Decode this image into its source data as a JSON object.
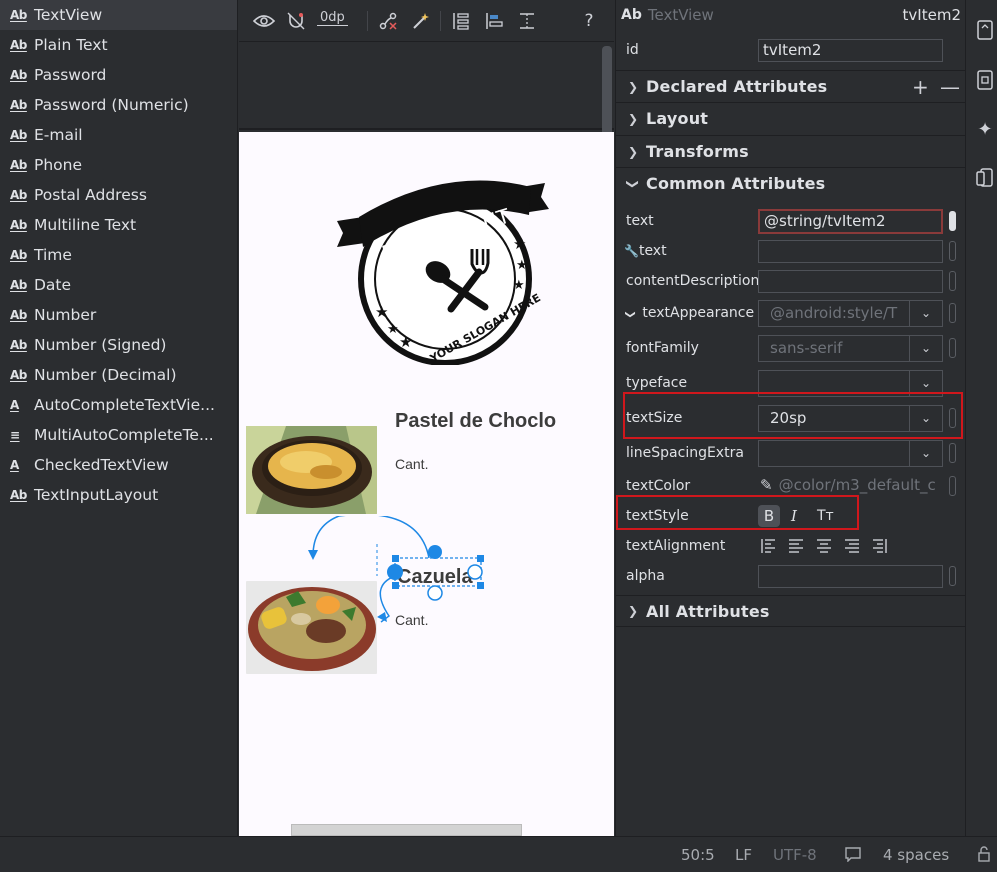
{
  "palette": {
    "items": [
      {
        "icon": "Ab",
        "label": "TextView"
      },
      {
        "icon": "Ab",
        "label": "Plain Text"
      },
      {
        "icon": "Ab",
        "label": "Password"
      },
      {
        "icon": "Ab",
        "label": "Password (Numeric)"
      },
      {
        "icon": "Ab",
        "label": "E-mail"
      },
      {
        "icon": "Ab",
        "label": "Phone"
      },
      {
        "icon": "Ab",
        "label": "Postal Address"
      },
      {
        "icon": "Ab",
        "label": "Multiline Text"
      },
      {
        "icon": "Ab",
        "label": "Time"
      },
      {
        "icon": "Ab",
        "label": "Date"
      },
      {
        "icon": "Ab",
        "label": "Number"
      },
      {
        "icon": "Ab",
        "label": "Number (Signed)"
      },
      {
        "icon": "Ab",
        "label": "Number (Decimal)"
      },
      {
        "icon": "A",
        "label": "AutoCompleteTextVie..."
      },
      {
        "icon": "≡",
        "label": "MultiAutoCompleteTe..."
      },
      {
        "icon": "A",
        "label": "CheckedTextView"
      },
      {
        "icon": "Ab",
        "label": "TextInputLayout"
      }
    ]
  },
  "toolbar": {
    "margin_value": "0dp",
    "help": "?"
  },
  "device": {
    "logo_text": "RESTAURANT",
    "logo_slogan": "YOUR SLOGAN HERE",
    "dish1_title": "Pastel de Choclo",
    "dish1_cant": "Cant.",
    "dish2_title": "Cazuela",
    "dish2_cant": "Cant."
  },
  "attributes": {
    "header_icon": "Ab",
    "header_type": "TextView",
    "header_id": "tvItem2",
    "id_label": "id",
    "id_value": "tvItem2",
    "sections": {
      "declared": "Declared Attributes",
      "layout": "Layout",
      "transforms": "Transforms",
      "common": "Common Attributes",
      "all": "All Attributes"
    },
    "rows": {
      "text_label": "text",
      "text_value": "@string/tvItem2",
      "tools_text_label": "text",
      "content_desc_label": "contentDescription",
      "text_appearance_label": "textAppearance",
      "text_appearance_value": "@android:style/T",
      "font_family_label": "fontFamily",
      "font_family_value": "sans-serif",
      "typeface_label": "typeface",
      "text_size_label": "textSize",
      "text_size_value": "20sp",
      "line_spacing_label": "lineSpacingExtra",
      "text_color_label": "textColor",
      "text_color_value": "@color/m3_default_c",
      "text_style_label": "textStyle",
      "text_alignment_label": "textAlignment",
      "alpha_label": "alpha"
    },
    "style_buttons": {
      "bold": "B",
      "italic": "I",
      "caps": "Tт"
    }
  },
  "status": {
    "position": "50:5",
    "line_ending": "LF",
    "encoding": "UTF-8",
    "indent": "4 spaces"
  },
  "colors": {
    "highlight_red": "#d0171c",
    "selection_blue": "#1e88e5",
    "panel_bg": "#2b2d30"
  }
}
